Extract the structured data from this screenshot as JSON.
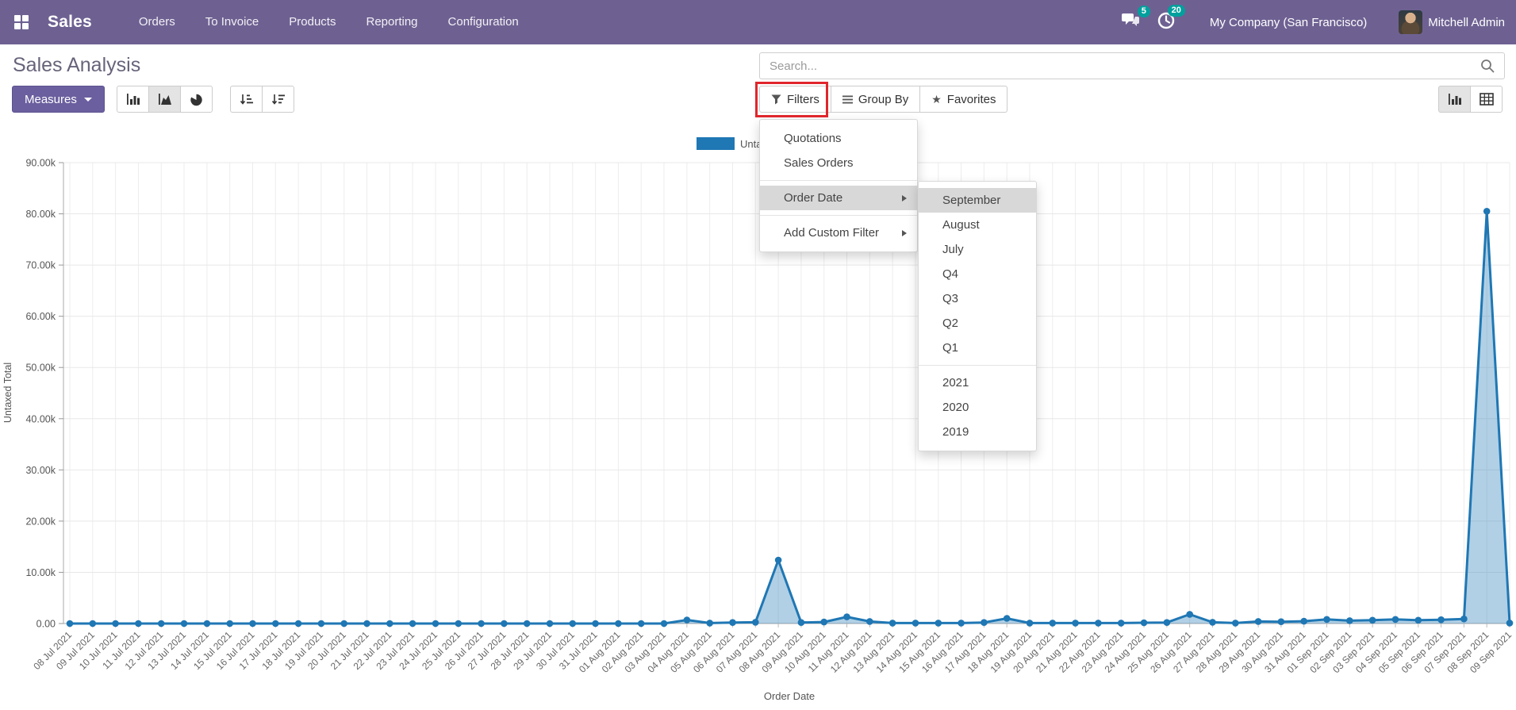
{
  "navbar": {
    "app_name": "Sales",
    "menus": [
      "Orders",
      "To Invoice",
      "Products",
      "Reporting",
      "Configuration"
    ],
    "messages_badge": "5",
    "activities_badge": "20",
    "company_name": "My Company (San Francisco)",
    "user_name": "Mitchell Admin"
  },
  "control_panel": {
    "title": "Sales Analysis",
    "search_placeholder": "Search...",
    "measures_label": "Measures",
    "filters_label": "Filters",
    "group_by_label": "Group By",
    "favorites_label": "Favorites"
  },
  "filters_menu": {
    "items": [
      {
        "label": "Quotations",
        "submenu": false,
        "highlighted": false
      },
      {
        "label": "Sales Orders",
        "submenu": false,
        "highlighted": false
      },
      {
        "divider": true
      },
      {
        "label": "Order Date",
        "submenu": true,
        "highlighted": true
      },
      {
        "divider": true
      },
      {
        "label": "Add Custom Filter",
        "submenu": true,
        "highlighted": false
      }
    ]
  },
  "order_date_submenu": {
    "items": [
      {
        "label": "September",
        "highlighted": true
      },
      {
        "label": "August",
        "highlighted": false
      },
      {
        "label": "July",
        "highlighted": false
      },
      {
        "label": "Q4",
        "highlighted": false
      },
      {
        "label": "Q3",
        "highlighted": false
      },
      {
        "label": "Q2",
        "highlighted": false
      },
      {
        "label": "Q1",
        "highlighted": false
      },
      {
        "divider": true
      },
      {
        "label": "2021",
        "highlighted": false
      },
      {
        "label": "2020",
        "highlighted": false
      },
      {
        "label": "2019",
        "highlighted": false
      }
    ]
  },
  "chart_data": {
    "type": "area",
    "legend": [
      "Untaxed Total"
    ],
    "legend_position": "top-center",
    "xlabel": "Order Date",
    "ylabel": "Untaxed Total",
    "ylim": [
      0,
      90000
    ],
    "grid": true,
    "y_tick_labels": [
      "0.00",
      "10.00k",
      "20.00k",
      "30.00k",
      "40.00k",
      "50.00k",
      "60.00k",
      "70.00k",
      "80.00k",
      "90.00k"
    ],
    "x": [
      "08 Jul 2021",
      "09 Jul 2021",
      "10 Jul 2021",
      "11 Jul 2021",
      "12 Jul 2021",
      "13 Jul 2021",
      "14 Jul 2021",
      "15 Jul 2021",
      "16 Jul 2021",
      "17 Jul 2021",
      "18 Jul 2021",
      "19 Jul 2021",
      "20 Jul 2021",
      "21 Jul 2021",
      "22 Jul 2021",
      "23 Jul 2021",
      "24 Jul 2021",
      "25 Jul 2021",
      "26 Jul 2021",
      "27 Jul 2021",
      "28 Jul 2021",
      "29 Jul 2021",
      "30 Jul 2021",
      "31 Jul 2021",
      "01 Aug 2021",
      "02 Aug 2021",
      "03 Aug 2021",
      "04 Aug 2021",
      "05 Aug 2021",
      "06 Aug 2021",
      "07 Aug 2021",
      "08 Aug 2021",
      "09 Aug 2021",
      "10 Aug 2021",
      "11 Aug 2021",
      "12 Aug 2021",
      "13 Aug 2021",
      "14 Aug 2021",
      "15 Aug 2021",
      "16 Aug 2021",
      "17 Aug 2021",
      "18 Aug 2021",
      "19 Aug 2021",
      "20 Aug 2021",
      "21 Aug 2021",
      "22 Aug 2021",
      "23 Aug 2021",
      "24 Aug 2021",
      "25 Aug 2021",
      "26 Aug 2021",
      "27 Aug 2021",
      "28 Aug 2021",
      "29 Aug 2021",
      "30 Aug 2021",
      "31 Aug 2021",
      "01 Sep 2021",
      "02 Sep 2021",
      "03 Sep 2021",
      "04 Sep 2021",
      "05 Sep 2021",
      "06 Sep 2021",
      "07 Sep 2021",
      "08 Sep 2021",
      "09 Sep 2021"
    ],
    "series": [
      {
        "name": "Untaxed Total",
        "values": [
          0,
          0,
          0,
          0,
          0,
          0,
          0,
          0,
          0,
          0,
          0,
          0,
          0,
          0,
          0,
          0,
          0,
          0,
          0,
          0,
          0,
          0,
          0,
          0,
          0,
          0,
          0,
          700,
          100,
          200,
          250,
          12400,
          200,
          300,
          1300,
          400,
          100,
          100,
          100,
          100,
          200,
          1000,
          100,
          100,
          100,
          100,
          100,
          150,
          200,
          1800,
          250,
          100,
          400,
          350,
          450,
          800,
          550,
          650,
          800,
          650,
          750,
          900,
          80500,
          100
        ]
      }
    ],
    "line_color": "#1f77b4",
    "fill_opacity": 0.35
  },
  "colors": {
    "navbar_bg": "#6e6192",
    "primary_button": "#6b5f9f",
    "badge": "#00a09d",
    "highlight_box": "#e0262c",
    "menu_highlight": "#d8d8d8",
    "series_blue": "#1f77b4"
  }
}
